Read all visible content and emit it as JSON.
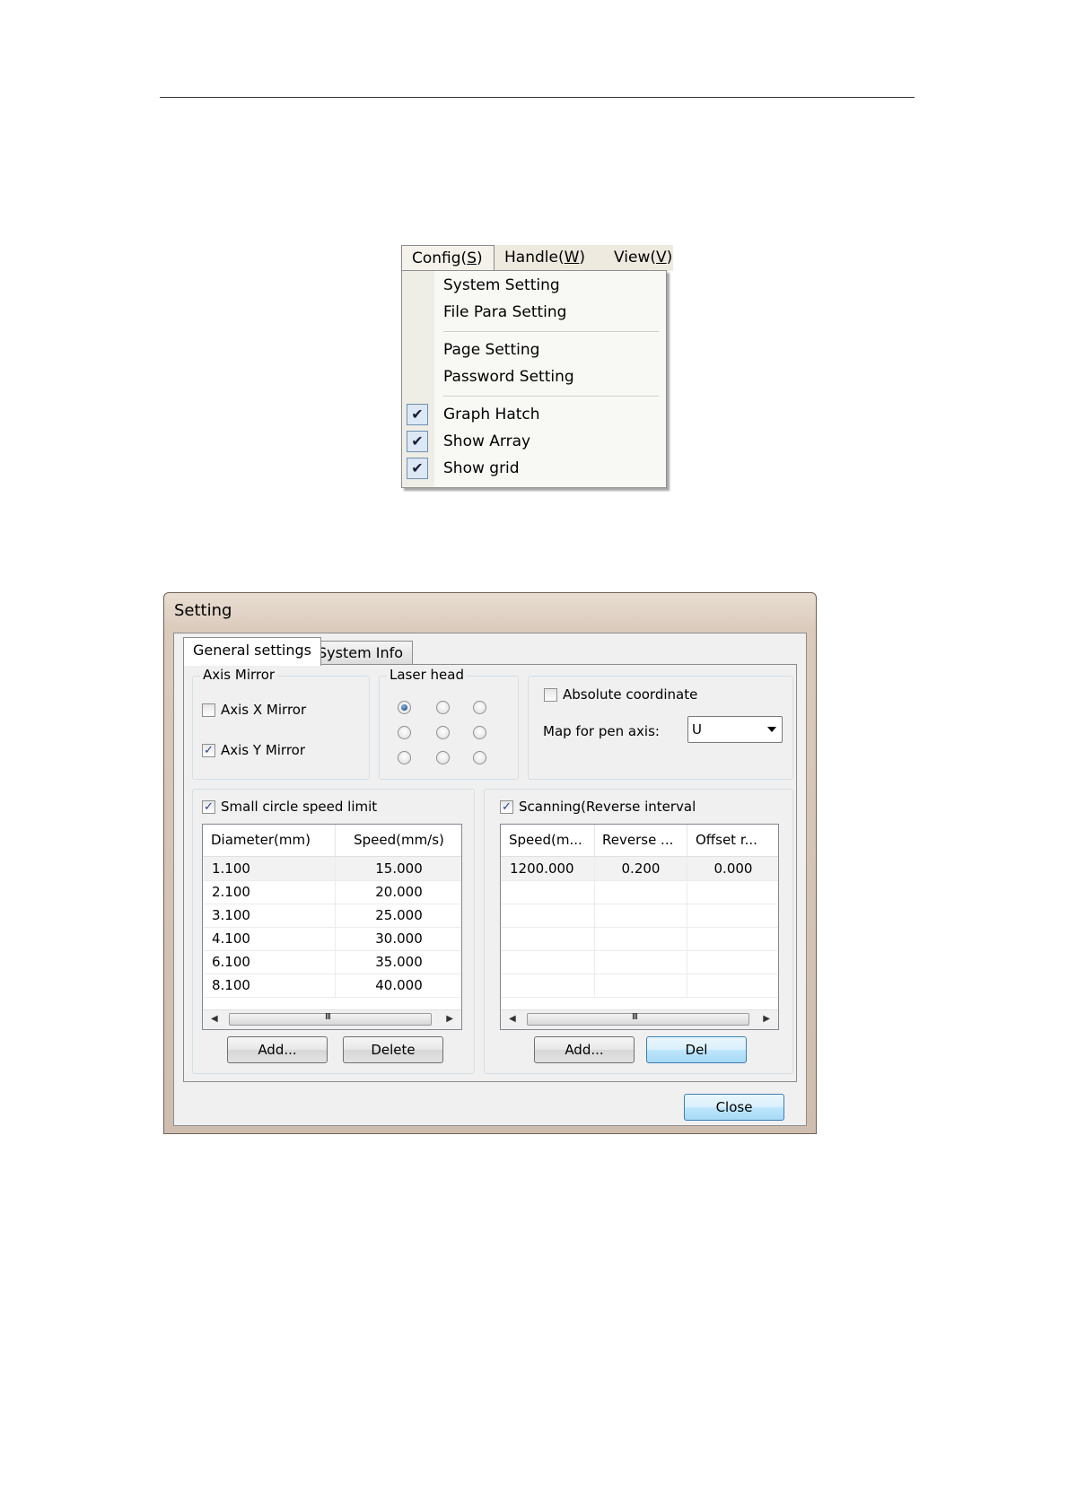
{
  "menu": {
    "bar": [
      {
        "pre": "Config(",
        "key": "S",
        "post": ")"
      },
      {
        "pre": "Handle(",
        "key": "W",
        "post": ")"
      },
      {
        "pre": "View(",
        "key": "V",
        "post": ")"
      }
    ],
    "items": [
      {
        "label": "System Setting",
        "checked": false
      },
      {
        "label": "File Para Setting",
        "checked": false
      },
      {
        "label": "Page Setting",
        "checked": false
      },
      {
        "label": "Password Setting",
        "checked": false
      },
      {
        "label": "Graph Hatch",
        "checked": true
      },
      {
        "label": "Show Array",
        "checked": true
      },
      {
        "label": "Show grid",
        "checked": true
      }
    ]
  },
  "dialog": {
    "title": "Setting",
    "tabs": [
      "General settings",
      "System Info"
    ],
    "axis_mirror": {
      "label": "Axis Mirror",
      "x_label": "Axis X Mirror",
      "x_checked": false,
      "y_label": "Axis Y Mirror",
      "y_checked": true
    },
    "laser_head": {
      "label": "Laser head",
      "selected_index": 0
    },
    "absolute_coordinate": {
      "label": "Absolute coordinate",
      "checked": false
    },
    "map_pen_axis": {
      "label": "Map for pen axis:",
      "value": "U"
    },
    "small_circle": {
      "label": "Small circle speed limit",
      "checked": true,
      "columns": [
        "Diameter(mm)",
        "Speed(mm/s)"
      ],
      "rows": [
        [
          "1.100",
          "15.000"
        ],
        [
          "2.100",
          "20.000"
        ],
        [
          "3.100",
          "25.000"
        ],
        [
          "4.100",
          "30.000"
        ],
        [
          "6.100",
          "35.000"
        ],
        [
          "8.100",
          "40.000"
        ]
      ],
      "scroll_grip": "III",
      "add_label": "Add...",
      "delete_label": "Delete"
    },
    "scanning": {
      "label": "Scanning(Reverse interval",
      "checked": true,
      "columns": [
        "Speed(m...",
        "Reverse ...",
        "Offset r..."
      ],
      "rows": [
        [
          "1200.000",
          "0.200",
          "0.000"
        ]
      ],
      "scroll_grip": "III",
      "add_label": "Add...",
      "del_label": "Del"
    },
    "close_label": "Close"
  }
}
